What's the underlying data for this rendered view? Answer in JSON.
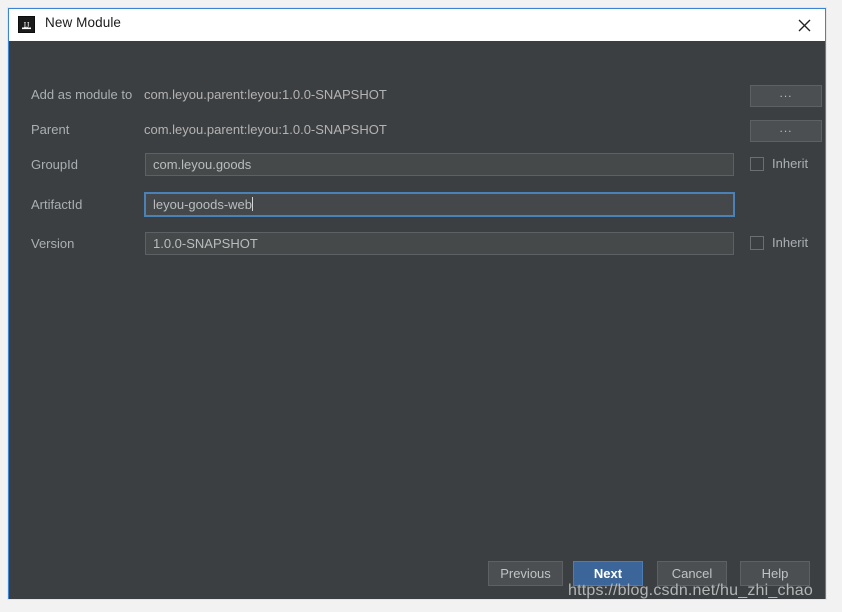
{
  "window": {
    "title": "New Module",
    "icon": "intellij-idea-icon",
    "close_icon": "close-icon",
    "accent_border": "#3c84d4",
    "background": "#3c3f41"
  },
  "form": {
    "rows": [
      {
        "label": "Add as module to",
        "value": "com.leyou.parent:leyou:1.0.0-SNAPSHOT",
        "type": "static",
        "browse_label": "..."
      },
      {
        "label": "Parent",
        "value": "com.leyou.parent:leyou:1.0.0-SNAPSHOT",
        "type": "static",
        "browse_label": "..."
      },
      {
        "label": "GroupId",
        "value": "com.leyou.goods",
        "type": "input",
        "focused": false,
        "inherit_label": "Inherit",
        "inherit_checked": false
      },
      {
        "label": "ArtifactId",
        "value": "leyou-goods-web",
        "type": "input",
        "focused": true,
        "inherit_label": "",
        "inherit_checked": false
      },
      {
        "label": "Version",
        "value": "1.0.0-SNAPSHOT",
        "type": "input",
        "focused": false,
        "inherit_label": "Inherit",
        "inherit_checked": false
      }
    ]
  },
  "footer": {
    "buttons": [
      {
        "label": "Previous",
        "default": false
      },
      {
        "label": "Next",
        "default": true
      },
      {
        "label": "Cancel",
        "default": false
      },
      {
        "label": "Help",
        "default": false
      }
    ]
  },
  "watermark": {
    "text": "https://blog.csdn.net/hu_zhi_chao"
  }
}
